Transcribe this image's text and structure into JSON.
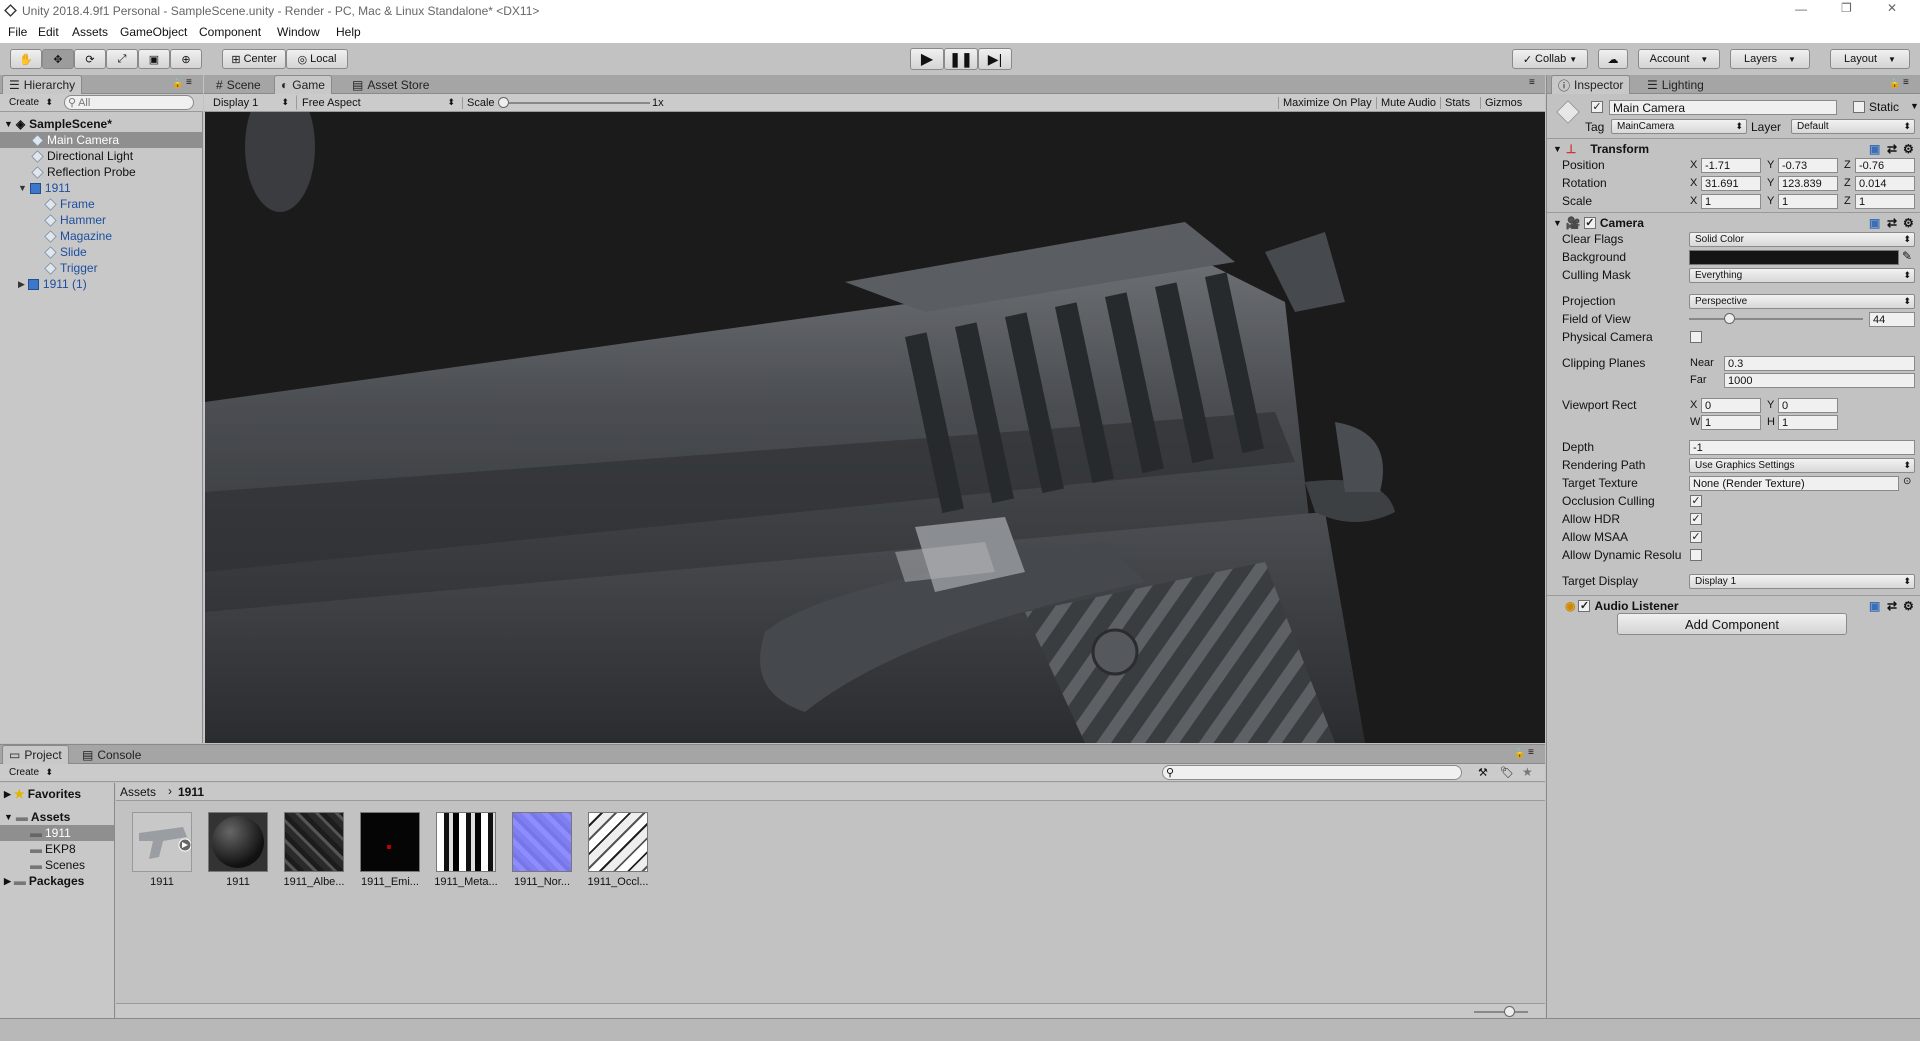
{
  "window": {
    "title": "Unity 2018.4.9f1 Personal - SampleScene.unity - Render - PC, Mac & Linux Standalone* <DX11>"
  },
  "menu": [
    "File",
    "Edit",
    "Assets",
    "GameObject",
    "Component",
    "Window",
    "Help"
  ],
  "toolbar": {
    "center": "Center",
    "local": "Local",
    "collab": "Collab",
    "account": "Account",
    "layers": "Layers",
    "layout": "Layout"
  },
  "hierarchy": {
    "tab": "Hierarchy",
    "create": "Create",
    "search": "All",
    "scene": "SampleScene*",
    "items": [
      "Main Camera",
      "Directional Light",
      "Reflection Probe"
    ],
    "prefab": "1911",
    "children": [
      "Frame",
      "Hammer",
      "Magazine",
      "Slide",
      "Trigger"
    ],
    "prefab2": "1911 (1)"
  },
  "view": {
    "tabs": [
      "Scene",
      "Game",
      "Asset Store"
    ],
    "display": "Display 1",
    "aspect": "Free Aspect",
    "scale_label": "Scale",
    "scale_value": "1x",
    "buttons": [
      "Maximize On Play",
      "Mute Audio",
      "Stats",
      "Gizmos"
    ]
  },
  "inspector": {
    "tabs": [
      "Inspector",
      "Lighting"
    ],
    "name": "Main Camera",
    "static": "Static",
    "tag_label": "Tag",
    "tag": "MainCamera",
    "layer_label": "Layer",
    "layer": "Default",
    "transform": {
      "title": "Transform",
      "position": "Position",
      "rotation": "Rotation",
      "scale": "Scale",
      "pos": [
        "-1.71",
        "-0.73",
        "-0.76"
      ],
      "rot": [
        "31.691",
        "123.839",
        "0.014"
      ],
      "scl": [
        "1",
        "1",
        "1"
      ]
    },
    "camera": {
      "title": "Camera",
      "clear_flags": "Clear Flags",
      "clear_flags_v": "Solid Color",
      "background": "Background",
      "background_color": "#141414",
      "culling": "Culling Mask",
      "culling_v": "Everything",
      "projection": "Projection",
      "projection_v": "Perspective",
      "fov": "Field of View",
      "fov_v": "44",
      "fov_fraction": 0.2,
      "physical": "Physical Camera",
      "clipping": "Clipping Planes",
      "near_l": "Near",
      "near": "0.3",
      "far_l": "Far",
      "far": "1000",
      "viewport": "Viewport Rect",
      "vx": "0",
      "vy": "0",
      "vw": "1",
      "vh": "1",
      "depth": "Depth",
      "depth_v": "-1",
      "rpath": "Rendering Path",
      "rpath_v": "Use Graphics Settings",
      "ttex": "Target Texture",
      "ttex_v": "None (Render Texture)",
      "occ": "Occlusion Culling",
      "hdr": "Allow HDR",
      "msaa": "Allow MSAA",
      "dyn": "Allow Dynamic Resolu",
      "tdisp": "Target Display",
      "tdisp_v": "Display 1"
    },
    "audio": "Audio Listener",
    "add": "Add Component"
  },
  "project": {
    "tabs": [
      "Project",
      "Console"
    ],
    "create": "Create",
    "favorites": "Favorites",
    "assets": "Assets",
    "folders": [
      "1911",
      "EKP8",
      "Scenes"
    ],
    "packages": "Packages",
    "crumb": [
      "Assets",
      "1911"
    ],
    "files": [
      "1911",
      "1911",
      "1911_Albe...",
      "1911_Emi...",
      "1911_Meta...",
      "1911_Nor...",
      "1911_Occl..."
    ]
  }
}
